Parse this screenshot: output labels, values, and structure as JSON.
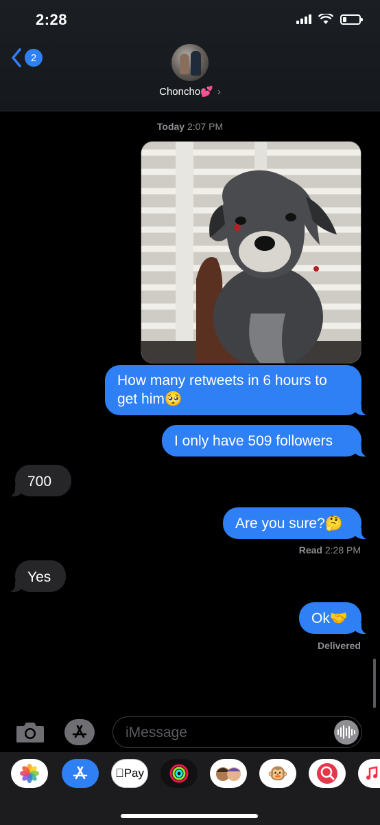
{
  "status_bar": {
    "time": "2:28"
  },
  "header": {
    "back_badge": "2",
    "contact_name": "Choncho💕",
    "chevron": "›"
  },
  "thread": {
    "timestamp_day": "Today",
    "timestamp_time": "2:07 PM",
    "messages": [
      {
        "from": "me",
        "type": "image",
        "alt": "puppy photo"
      },
      {
        "from": "me",
        "line1": "How many retweets in 6 hours to",
        "line2": "get him🥺"
      },
      {
        "from": "me",
        "text": "I only have 509 followers"
      },
      {
        "from": "them",
        "text": "700"
      },
      {
        "from": "me",
        "text": "Are you sure?🤔"
      },
      {
        "from": "them",
        "text": "Yes"
      },
      {
        "from": "me",
        "text": "Ok🤝"
      }
    ],
    "read_label": "Read",
    "read_time": "2:28 PM",
    "delivered_label": "Delivered"
  },
  "compose": {
    "placeholder": "iMessage"
  },
  "app_drawer": {
    "apps": [
      {
        "name": "photos-icon",
        "label": ""
      },
      {
        "name": "app-store-icon",
        "label": ""
      },
      {
        "name": "apple-pay-icon",
        "label": "Pay"
      },
      {
        "name": "activity-icon",
        "label": ""
      },
      {
        "name": "memoji-icon",
        "label": ""
      },
      {
        "name": "animoji-icon",
        "label": "🐵"
      },
      {
        "name": "search-images-icon",
        "label": ""
      },
      {
        "name": "music-icon",
        "label": ""
      }
    ]
  },
  "colors": {
    "sent_bubble": "#2f7ff5",
    "received_bubble": "#262628",
    "background": "#000000"
  }
}
